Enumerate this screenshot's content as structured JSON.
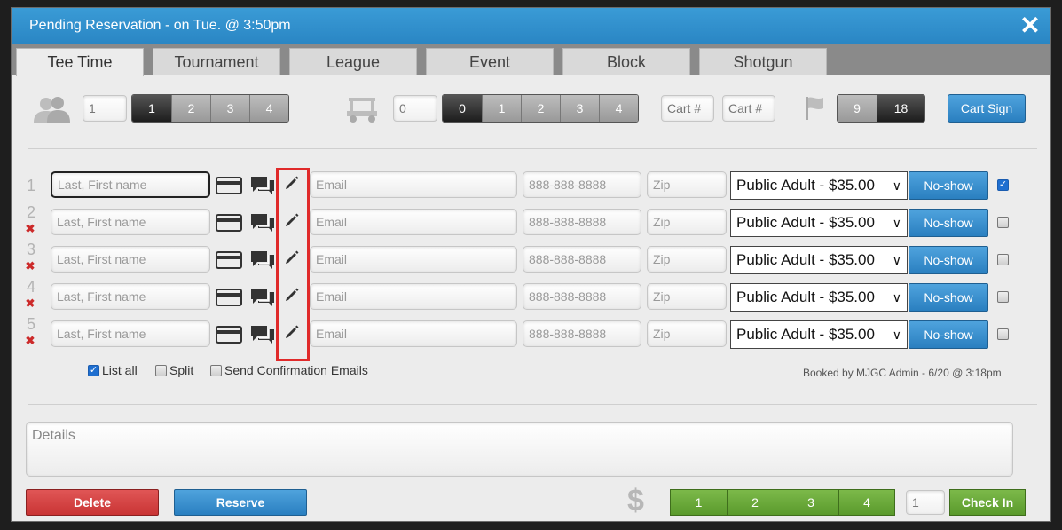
{
  "dialog": {
    "title": "Pending Reservation - on Tue. @ 3:50pm",
    "close_label": "✕"
  },
  "tabs": [
    {
      "label": "Tee Time",
      "active": true
    },
    {
      "label": "Tournament",
      "active": false
    },
    {
      "label": "League",
      "active": false
    },
    {
      "label": "Event",
      "active": false
    },
    {
      "label": "Block",
      "active": false
    },
    {
      "label": "Shotgun",
      "active": false
    }
  ],
  "players": {
    "icon": "players-icon",
    "count_value": "1",
    "options": [
      "1",
      "2",
      "3",
      "4"
    ],
    "selected": "1"
  },
  "carts": {
    "icon": "golf-cart-icon",
    "count_value": "0",
    "options": [
      "0",
      "1",
      "2",
      "3",
      "4"
    ],
    "selected": "0",
    "cart1_placeholder": "Cart #",
    "cart2_placeholder": "Cart #"
  },
  "holes": {
    "icon": "flag-icon",
    "options": [
      "9",
      "18"
    ],
    "selected": "18"
  },
  "cart_sign_label": "Cart Sign",
  "rows": [
    {
      "number": "1",
      "removable": false,
      "name_placeholder": "Last, First name",
      "email_placeholder": "Email",
      "phone_placeholder": "888-888-8888",
      "zip_placeholder": "Zip",
      "rate": "Public Adult - $35.00",
      "noshow_label": "No-show",
      "checked": true
    },
    {
      "number": "2",
      "removable": true,
      "name_placeholder": "Last, First name",
      "email_placeholder": "Email",
      "phone_placeholder": "888-888-8888",
      "zip_placeholder": "Zip",
      "rate": "Public Adult - $35.00",
      "noshow_label": "No-show",
      "checked": false
    },
    {
      "number": "3",
      "removable": true,
      "name_placeholder": "Last, First name",
      "email_placeholder": "Email",
      "phone_placeholder": "888-888-8888",
      "zip_placeholder": "Zip",
      "rate": "Public Adult - $35.00",
      "noshow_label": "No-show",
      "checked": false
    },
    {
      "number": "4",
      "removable": true,
      "name_placeholder": "Last, First name",
      "email_placeholder": "Email",
      "phone_placeholder": "888-888-8888",
      "zip_placeholder": "Zip",
      "rate": "Public Adult - $35.00",
      "noshow_label": "No-show",
      "checked": false
    },
    {
      "number": "5",
      "removable": true,
      "name_placeholder": "Last, First name",
      "email_placeholder": "Email",
      "phone_placeholder": "888-888-8888",
      "zip_placeholder": "Zip",
      "rate": "Public Adult - $35.00",
      "noshow_label": "No-show",
      "checked": false
    }
  ],
  "options": {
    "list_all": {
      "label": "List all",
      "checked": true
    },
    "split": {
      "label": "Split",
      "checked": false
    },
    "send_emails": {
      "label": "Send Confirmation Emails",
      "checked": false
    }
  },
  "booked_by": "Booked by MJGC Admin - 6/20 @ 3:18pm",
  "details_placeholder": "Details",
  "footer": {
    "delete_label": "Delete",
    "reserve_label": "Reserve",
    "dollar_symbol": "$",
    "pay_options": [
      "1",
      "2",
      "3",
      "4"
    ],
    "checkin_count": "1",
    "checkin_label": "Check In"
  },
  "colors": {
    "title_bar": "#2a86c4",
    "highlight": "#e02a2a",
    "delete": "#c93434",
    "checkin": "#5a9a2c"
  }
}
